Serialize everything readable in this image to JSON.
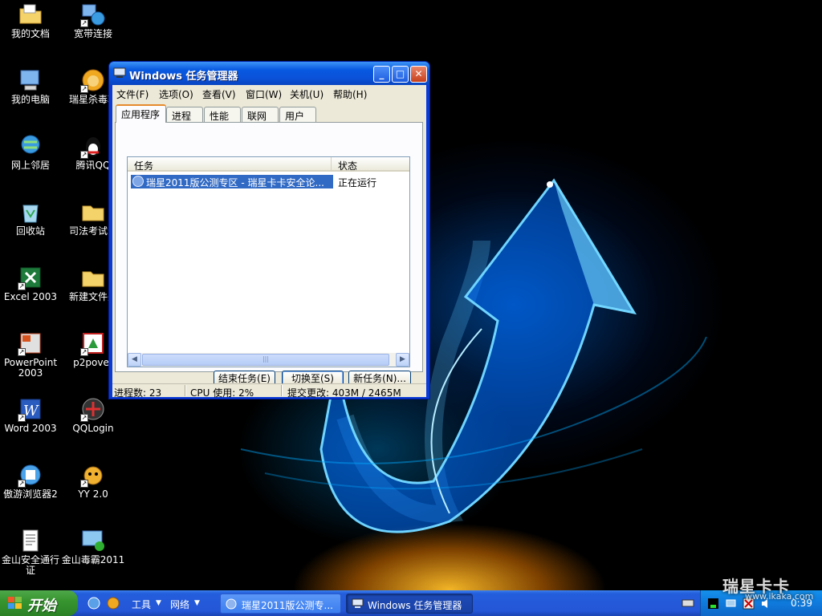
{
  "desktop": {
    "icons": [
      {
        "label": "我的文档"
      },
      {
        "label": "宽带连接"
      },
      {
        "label": "我的电脑"
      },
      {
        "label": "瑞星杀毒软"
      },
      {
        "label": "网上邻居"
      },
      {
        "label": "腾讯QQ"
      },
      {
        "label": "回收站"
      },
      {
        "label": "司法考试录"
      },
      {
        "label": "Excel 2003"
      },
      {
        "label": "新建文件夹"
      },
      {
        "label": "PowerPoint 2003"
      },
      {
        "label": "p2pover"
      },
      {
        "label": "Word 2003"
      },
      {
        "label": "QQLogin"
      },
      {
        "label": "傲游浏览器2"
      },
      {
        "label": "YY 2.0"
      },
      {
        "label": "金山安全通行证"
      },
      {
        "label": "金山毒霸2011"
      }
    ]
  },
  "window": {
    "title": "Windows 任务管理器",
    "buttons": {
      "minimize": "_",
      "maximize": "□",
      "close": "✕"
    },
    "menu": [
      "文件(F)",
      "选项(O)",
      "查看(V)",
      "窗口(W)",
      "关机(U)",
      "帮助(H)"
    ],
    "tabs": [
      "应用程序",
      "进程",
      "性能",
      "联网",
      "用户"
    ],
    "active_tab": "应用程序",
    "columns": [
      "任务",
      "状态"
    ],
    "rows": [
      {
        "task": "瑞星2011版公测专区 - 瑞星卡卡安全论...",
        "status": "正在运行"
      }
    ],
    "actions": {
      "end_task": "结束任务(E)",
      "switch_to": "切换至(S)",
      "new_task": "新任务(N)..."
    },
    "status": {
      "processes": "进程数: 23",
      "cpu": "CPU 使用: 2%",
      "commit": "提交更改: 403M / 2465M"
    }
  },
  "taskbar": {
    "start": "开始",
    "toolbars": [
      "工具",
      "网络"
    ],
    "tasks": [
      {
        "label": "瑞星2011版公测专..."
      },
      {
        "label": "Windows 任务管理器"
      }
    ],
    "clock": "0:39"
  },
  "watermark": {
    "line1": "瑞星卡卡",
    "line2": "www.ikaka.com"
  },
  "colors": {
    "titlebar": "#0a52d9",
    "taskbar": "#245edc",
    "start": "#37952f",
    "selection": "#316ac5",
    "tab_highlight": "#e68b2c"
  }
}
